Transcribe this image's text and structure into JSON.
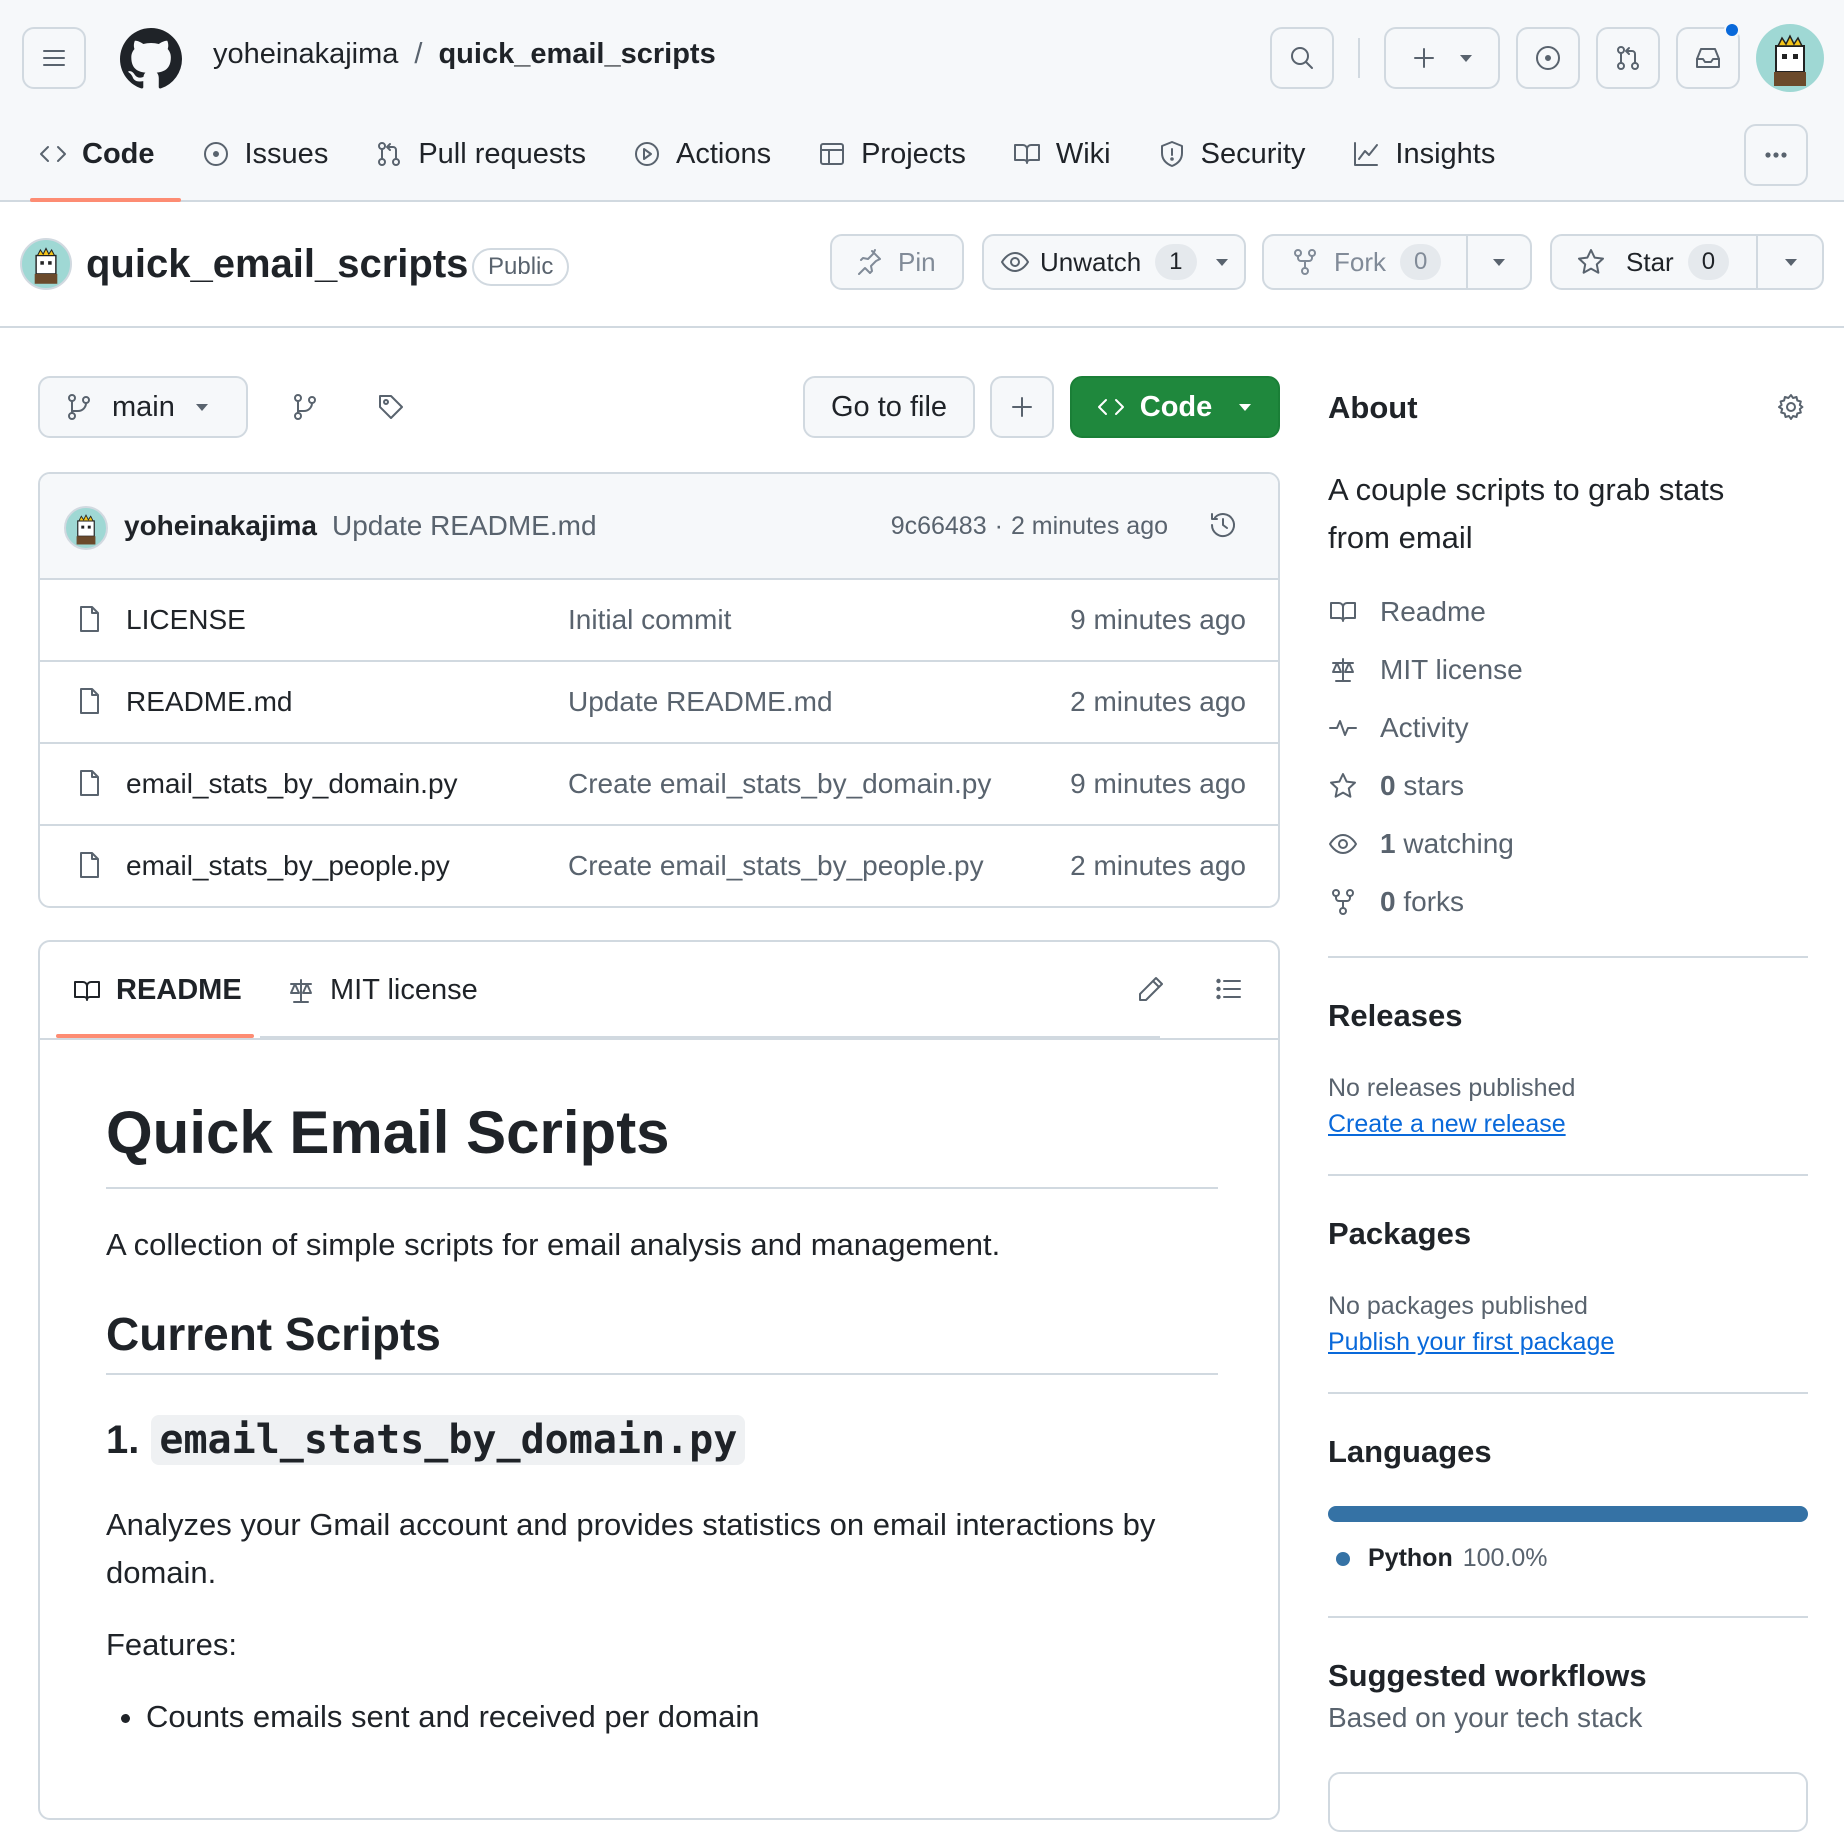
{
  "header": {
    "owner": "yoheinakajima",
    "separator": "/",
    "repo": "quick_email_scripts"
  },
  "nav": {
    "tabs": [
      {
        "label": "Code"
      },
      {
        "label": "Issues"
      },
      {
        "label": "Pull requests"
      },
      {
        "label": "Actions"
      },
      {
        "label": "Projects"
      },
      {
        "label": "Wiki"
      },
      {
        "label": "Security"
      },
      {
        "label": "Insights"
      }
    ]
  },
  "repo_header": {
    "title": "quick_email_scripts",
    "visibility": "Public",
    "pin_label": "Pin",
    "unwatch_label": "Unwatch",
    "watch_count": "1",
    "fork_label": "Fork",
    "fork_count": "0",
    "star_label": "Star",
    "star_count": "0"
  },
  "toolbar": {
    "branch": "main",
    "go_to_file": "Go to file",
    "code_button": "Code"
  },
  "commit": {
    "author": "yoheinakajima",
    "message": "Update README.md",
    "hash": "9c66483",
    "dot": "·",
    "time": "2 minutes ago"
  },
  "files": [
    {
      "name": "LICENSE",
      "message": "Initial commit",
      "time": "9 minutes ago"
    },
    {
      "name": "README.md",
      "message": "Update README.md",
      "time": "2 minutes ago"
    },
    {
      "name": "email_stats_by_domain.py",
      "message": "Create email_stats_by_domain.py",
      "time": "9 minutes ago"
    },
    {
      "name": "email_stats_by_people.py",
      "message": "Create email_stats_by_people.py",
      "time": "2 minutes ago"
    }
  ],
  "readme": {
    "tab_readme": "README",
    "tab_license": "MIT license",
    "h1": "Quick Email Scripts",
    "intro": "A collection of simple scripts for email analysis and management.",
    "h2": "Current Scripts",
    "h3_prefix": "1.",
    "h3_code": "email_stats_by_domain.py",
    "desc": "Analyzes your Gmail account and provides statistics on email interactions by domain.",
    "features_label": "Features:",
    "features": [
      "Counts emails sent and received per domain"
    ]
  },
  "about": {
    "title": "About",
    "description": "A couple scripts to grab stats from email",
    "readme": "Readme",
    "license": "MIT license",
    "activity": "Activity",
    "stars_count": "0",
    "stars_label": "stars",
    "watching_count": "1",
    "watching_label": "watching",
    "forks_count": "0",
    "forks_label": "forks"
  },
  "releases": {
    "title": "Releases",
    "empty": "No releases published",
    "link": "Create a new release"
  },
  "packages": {
    "title": "Packages",
    "empty": "No packages published",
    "link": "Publish your first package"
  },
  "languages": {
    "title": "Languages",
    "items": [
      {
        "name": "Python",
        "percent": "100.0%",
        "fraction": 1.0,
        "color": "#3572A5"
      }
    ]
  },
  "workflows": {
    "title": "Suggested workflows",
    "subtitle": "Based on your tech stack"
  },
  "colors": {
    "accent_green": "#1f883d",
    "tab_underline": "#fd8c73",
    "link_blue": "#0969da",
    "notification_dot": "#0969da"
  }
}
